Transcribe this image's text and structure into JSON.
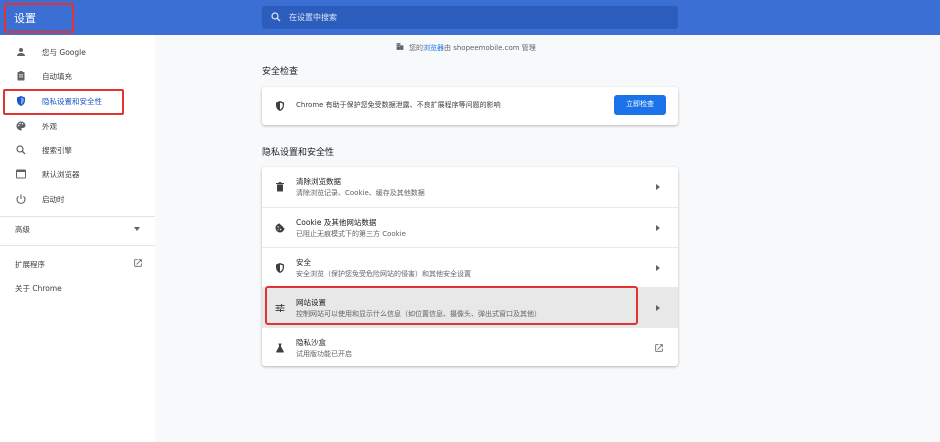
{
  "header": {
    "title": "设置",
    "search_placeholder": "在设置中搜索",
    "colors": {
      "header_bg": "#3c6fd3",
      "annotation_red": "#e23232"
    }
  },
  "sidebar": {
    "items": [
      {
        "label": "您与 Google",
        "icon": "person-icon"
      },
      {
        "label": "自动填充",
        "icon": "clipboard-icon"
      },
      {
        "label": "隐私设置和安全性",
        "icon": "shield-icon",
        "active": true
      },
      {
        "label": "外观",
        "icon": "palette-icon"
      },
      {
        "label": "搜索引擎",
        "icon": "search-icon"
      },
      {
        "label": "默认浏览器",
        "icon": "browser-icon"
      },
      {
        "label": "启动时",
        "icon": "power-icon"
      }
    ],
    "advanced": "高级",
    "extensions": "扩展程序",
    "about": "关于 Chrome"
  },
  "main": {
    "managed": {
      "prefix": "您的",
      "link": "浏览器",
      "suffix": "由 shopeemobile.com 管理"
    },
    "safety_check": {
      "title": "安全检查",
      "text": "Chrome 有助于保护您免受数据泄露、不良扩展程序等问题的影响",
      "button": "立即检查"
    },
    "privacy": {
      "title": "隐私设置和安全性",
      "rows": [
        {
          "title": "清除浏览数据",
          "subtitle": "清除浏览记录、Cookie、缓存及其他数据",
          "icon": "trash-icon"
        },
        {
          "title": "Cookie 及其他网站数据",
          "subtitle": "已阻止无痕模式下的第三方 Cookie",
          "icon": "cookie-icon"
        },
        {
          "title": "安全",
          "subtitle": "安全浏览（保护您免受危险网站的侵害）和其他安全设置",
          "icon": "security-shield-icon"
        },
        {
          "title": "网站设置",
          "subtitle": "控制网站可以使用和显示什么信息（如位置信息、摄像头、弹出式窗口及其他）",
          "icon": "sliders-icon"
        },
        {
          "title": "隐私沙盒",
          "subtitle": "试用版功能已开启",
          "icon": "flask-icon"
        }
      ]
    }
  }
}
